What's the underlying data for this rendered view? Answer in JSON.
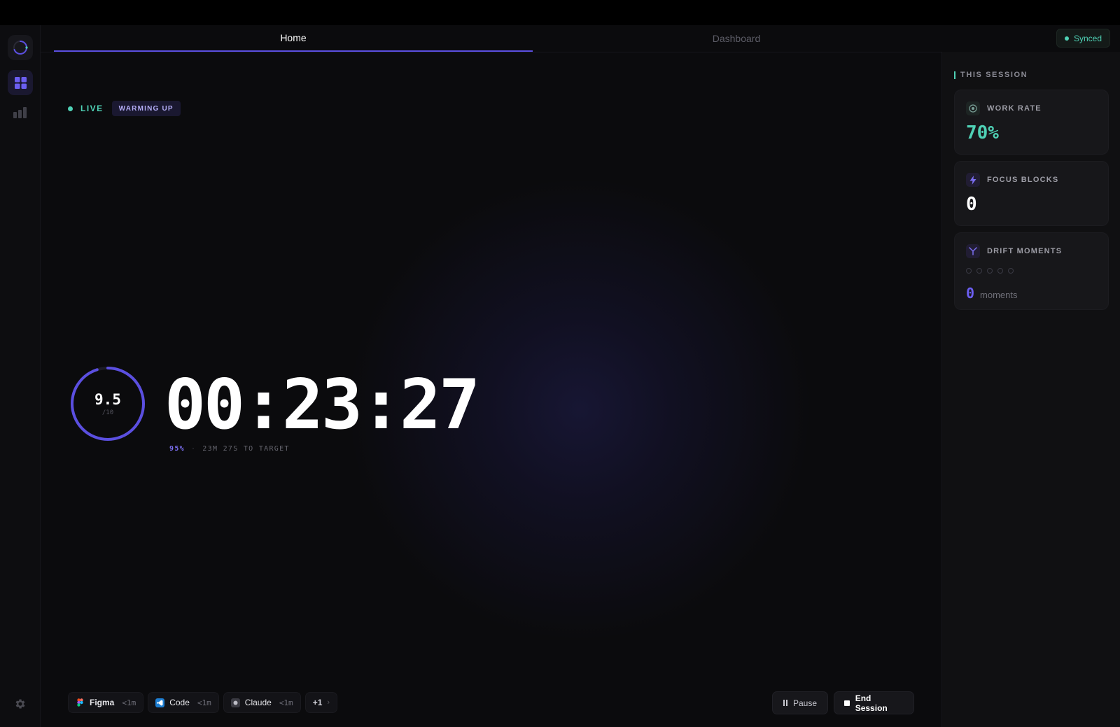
{
  "tabs": {
    "home": "Home",
    "dashboard": "Dashboard"
  },
  "sync": {
    "label": "Synced",
    "color": "#4fd1b5"
  },
  "status": {
    "live": "LIVE",
    "badge": "WARMING UP"
  },
  "score": {
    "value": "9.5",
    "max": "/10",
    "fraction": 0.95
  },
  "timer": {
    "display": "00:23:27"
  },
  "progress": {
    "percent": "95%",
    "separator": "·",
    "remaining": "23M 27S TO TARGET"
  },
  "apps": [
    {
      "name": "Figma",
      "time": "<1m",
      "icon": "figma-icon"
    },
    {
      "name": "Code",
      "time": "<1m",
      "icon": "vscode-icon"
    },
    {
      "name": "Claude",
      "time": "<1m",
      "icon": "claude-icon"
    }
  ],
  "apps_more": {
    "label": "+1",
    "chevron": "›"
  },
  "controls": {
    "pause": "Pause",
    "end": "End Session"
  },
  "panel": {
    "heading": "THIS SESSION",
    "work_rate": {
      "title": "WORK RATE",
      "value": "70%",
      "color": "#4fd1b5"
    },
    "focus_blocks": {
      "title": "FOCUS BLOCKS",
      "value": "0"
    },
    "drift_moments": {
      "title": "DRIFT MOMENTS",
      "count": "0",
      "unit": "moments",
      "dots": 5
    }
  },
  "colors": {
    "accent": "#5b4fe0",
    "teal": "#4fd1b5"
  }
}
